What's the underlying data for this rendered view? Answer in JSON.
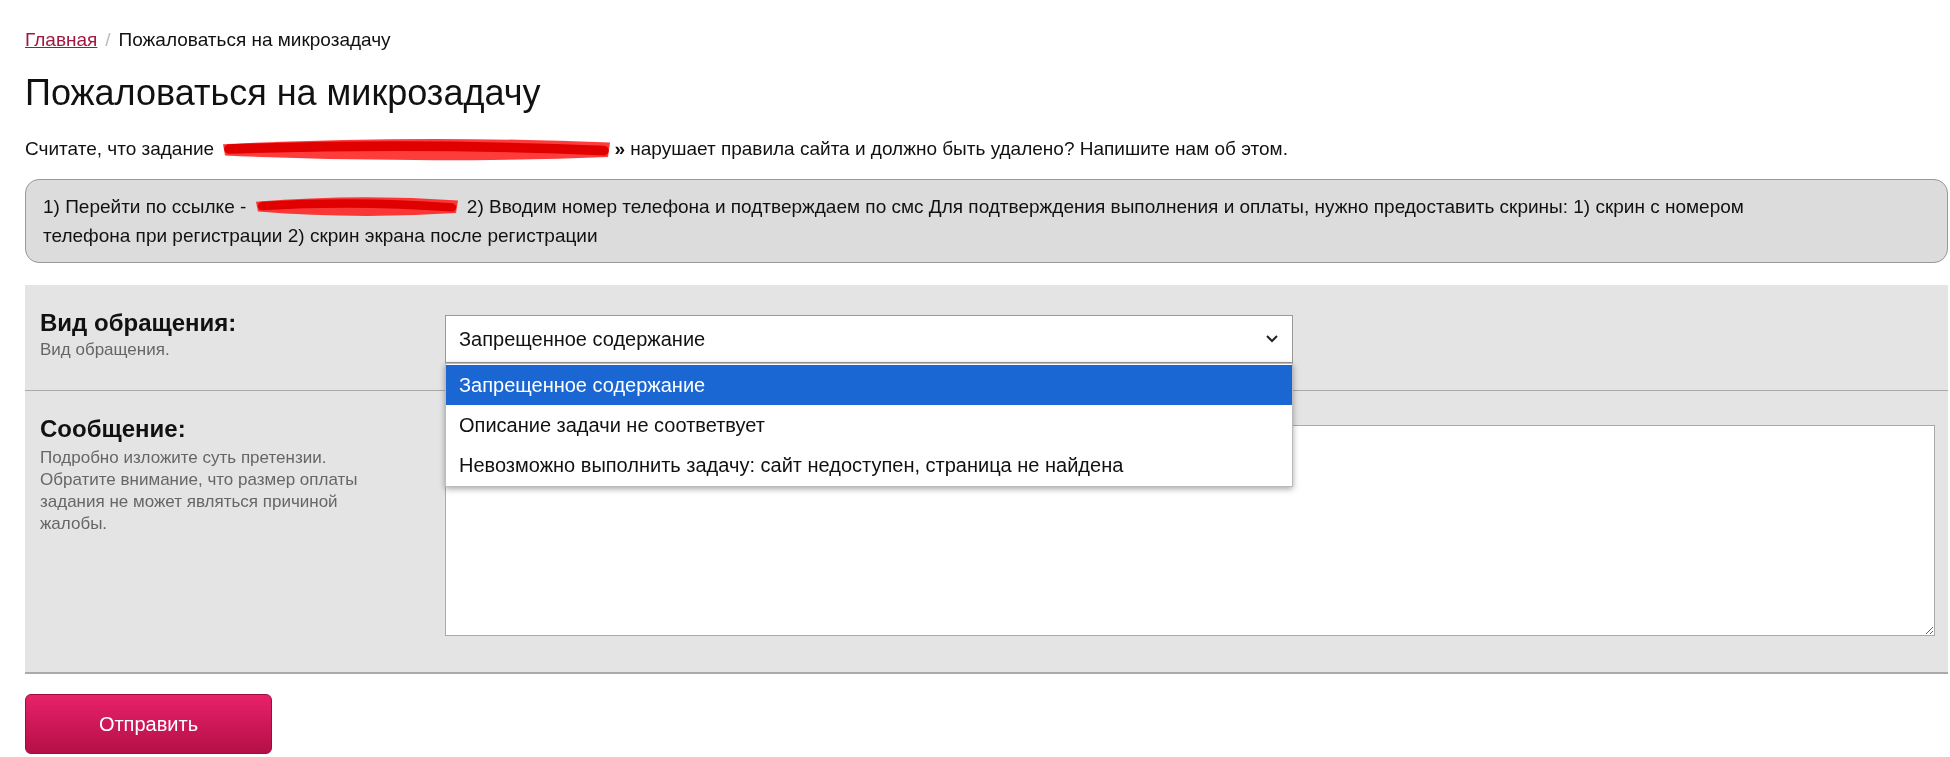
{
  "breadcrumb": {
    "home": "Главная",
    "separator": "/",
    "current": "Пожаловаться на микрозадачу"
  },
  "title": "Пожаловаться на микрозадачу",
  "intro": [
    {
      "kind": "text",
      "text": "Считате, что задание "
    },
    {
      "kind": "redaction"
    },
    {
      "kind": "text",
      "text": "**»** нарушает правила сайта и должно быть удалено? Напишите нам об этом."
    }
  ],
  "task_description": [
    [
      {
        "kind": "text",
        "text": "1) Перейти по ссылке - "
      },
      {
        "kind": "redaction"
      },
      {
        "kind": "text",
        "text": " 2) Вводим номер телефона и подтверждаем по смс Для подтверждения выполнения и оплаты, нужно предоставить скрины: 1) скрин с номером"
      }
    ],
    [
      {
        "kind": "text",
        "text": "телефона при регистрации 2) скрин экрана после регистрации"
      }
    ]
  ],
  "form": {
    "type_field": {
      "label": "Вид обращения:",
      "hint": "Вид обращения.",
      "value": "Запрещенное содержание",
      "expanded": true,
      "options": [
        {
          "label": "Запрещенное содержание",
          "selected": true
        },
        {
          "label": "Описание задачи не соответвует",
          "selected": false
        },
        {
          "label": "Невозможно выполнить задачу: сайт недоступен, страница не найдена",
          "selected": false
        }
      ]
    },
    "message_field": {
      "label": "Сообщение:",
      "hint": "Подробно изложите суть претензии. Обратите внимание, что размер оплаты задания не может являться причиной жалобы."
    }
  },
  "submit_button": "Отправить"
}
